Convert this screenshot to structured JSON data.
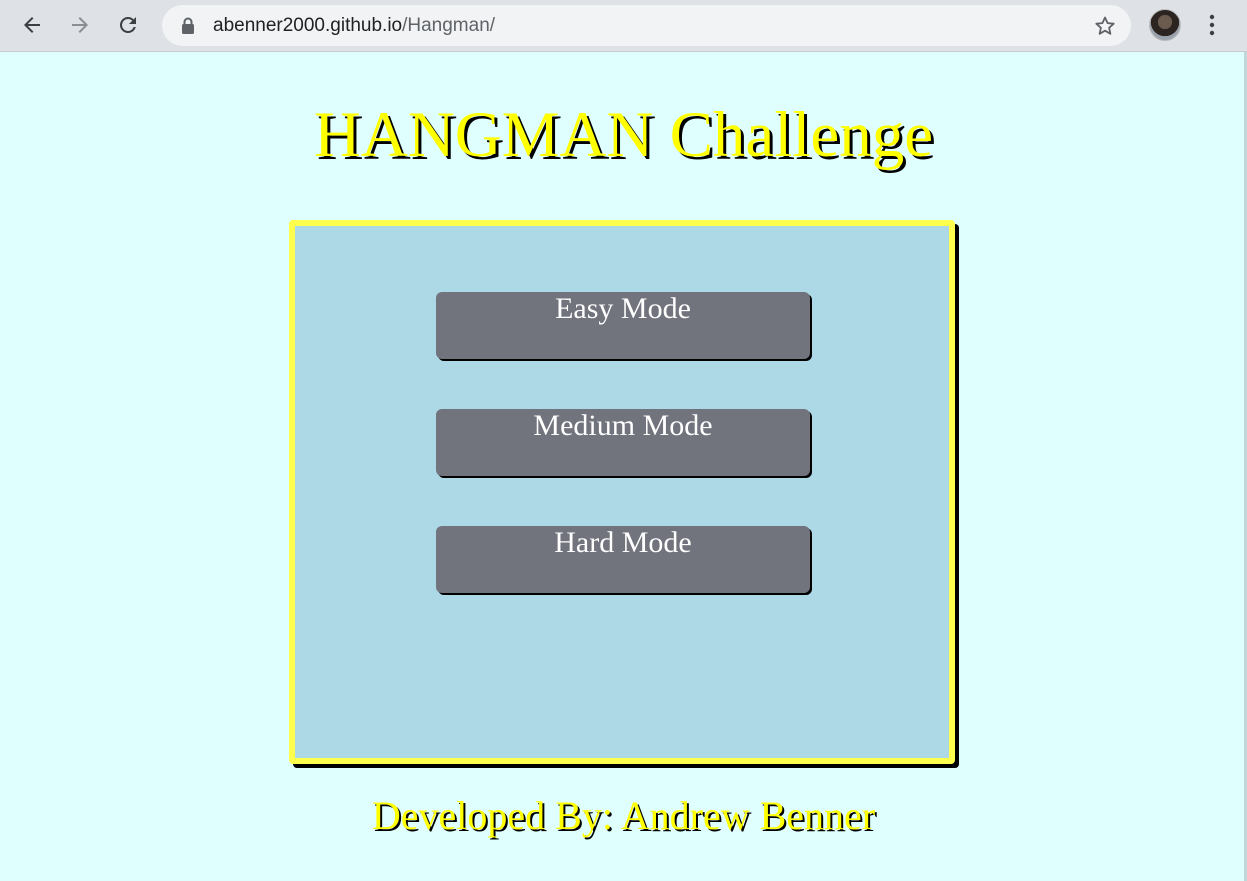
{
  "browser": {
    "url_host": "abenner2000.github.io",
    "url_path": "/Hangman/",
    "icons": [
      "back-arrow-icon",
      "forward-arrow-icon",
      "reload-icon",
      "lock-icon",
      "star-icon",
      "avatar",
      "more-vert-icon"
    ]
  },
  "page": {
    "title": "HANGMAN Challenge",
    "buttons": {
      "easy": "Easy Mode",
      "medium": "Medium Mode",
      "hard": "Hard Mode"
    },
    "footer": "Developed By: Andrew Benner"
  },
  "colors": {
    "background": "#dfffff",
    "title": "#ffff00",
    "panel": "#add8e6",
    "panel_border": "#ffff4d",
    "button": "#71737d"
  }
}
